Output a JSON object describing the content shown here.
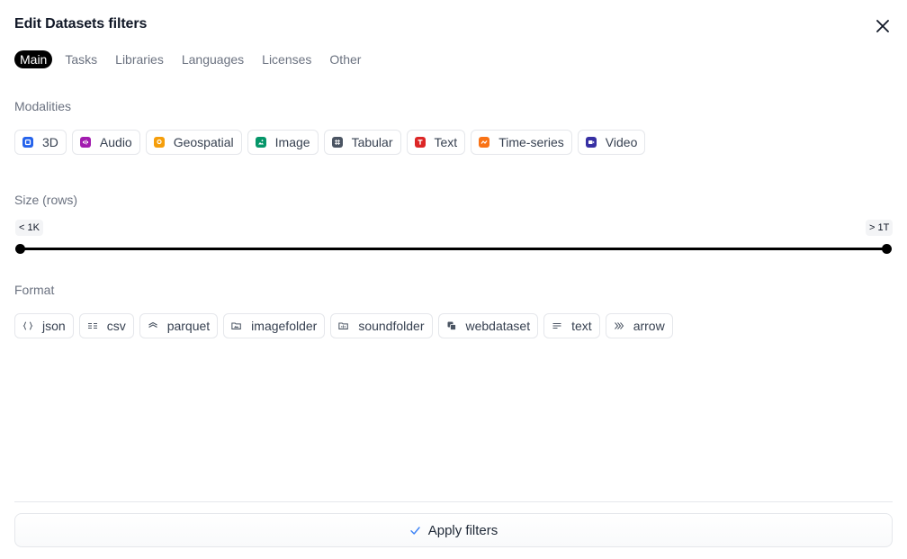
{
  "dialog": {
    "title": "Edit Datasets filters",
    "close_icon": "close-icon"
  },
  "tabs": [
    {
      "label": "Main",
      "active": true
    },
    {
      "label": "Tasks",
      "active": false
    },
    {
      "label": "Libraries",
      "active": false
    },
    {
      "label": "Languages",
      "active": false
    },
    {
      "label": "Licenses",
      "active": false
    },
    {
      "label": "Other",
      "active": false
    }
  ],
  "modalities": {
    "label": "Modalities",
    "items": [
      {
        "label": "3D",
        "icon": "cube-icon",
        "color": "#2563eb"
      },
      {
        "label": "Audio",
        "icon": "audio-wave-icon",
        "color": "#a21caf"
      },
      {
        "label": "Geospatial",
        "icon": "map-pin-icon",
        "color": "#f59e0b"
      },
      {
        "label": "Image",
        "icon": "image-icon",
        "color": "#059669"
      },
      {
        "label": "Tabular",
        "icon": "grid-icon",
        "color": "#4b5563"
      },
      {
        "label": "Text",
        "icon": "text-icon",
        "color": "#dc2626"
      },
      {
        "label": "Time-series",
        "icon": "trend-line-icon",
        "color": "#f97316"
      },
      {
        "label": "Video",
        "icon": "video-icon",
        "color": "#3730a3"
      }
    ]
  },
  "size": {
    "label": "Size (rows)",
    "min_label": "< 1K",
    "max_label": "> 1T"
  },
  "format": {
    "label": "Format",
    "items": [
      {
        "label": "json",
        "icon": "braces-icon"
      },
      {
        "label": "csv",
        "icon": "table-rows-icon"
      },
      {
        "label": "parquet",
        "icon": "layers-icon"
      },
      {
        "label": "imagefolder",
        "icon": "image-folder-icon"
      },
      {
        "label": "soundfolder",
        "icon": "sound-folder-icon"
      },
      {
        "label": "webdataset",
        "icon": "stack-icon"
      },
      {
        "label": "text",
        "icon": "text-lines-icon"
      },
      {
        "label": "arrow",
        "icon": "double-chevron-icon"
      }
    ]
  },
  "apply": {
    "label": "Apply filters",
    "icon": "check-icon"
  }
}
